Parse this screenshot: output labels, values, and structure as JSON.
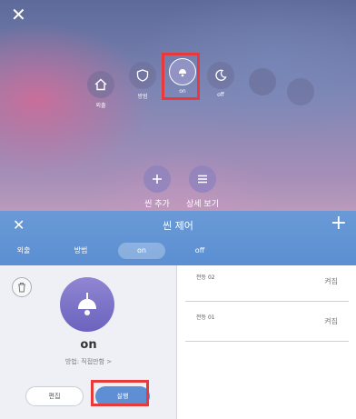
{
  "top_panel": {
    "scenes": [
      {
        "icon": "home-icon",
        "label": "외출"
      },
      {
        "icon": "shield-icon",
        "label": "방범"
      },
      {
        "icon": "lamp-icon",
        "label": "on"
      },
      {
        "icon": "moon-icon",
        "label": "off"
      },
      {
        "icon": "empty-icon",
        "label": ""
      },
      {
        "icon": "empty-icon",
        "label": ""
      }
    ],
    "actions": {
      "add_label": "씬 추가",
      "detail_label": "상세 보기"
    },
    "highlight_color": "#e83a3a"
  },
  "header": {
    "title": "씬 제어",
    "tabs": [
      {
        "label": "외출",
        "active": false
      },
      {
        "label": "방범",
        "active": false
      },
      {
        "label": "on",
        "active": true
      },
      {
        "label": "off",
        "active": false
      }
    ],
    "bg_color": "#5b8fd2"
  },
  "scene_detail": {
    "name": "on",
    "subtitle": "방법: 직접만함 >",
    "edit_label": "편집",
    "run_label": "실행"
  },
  "devices": [
    {
      "name": "전등 02",
      "state": "켜짐"
    },
    {
      "name": "전등 01",
      "state": "켜짐"
    }
  ]
}
